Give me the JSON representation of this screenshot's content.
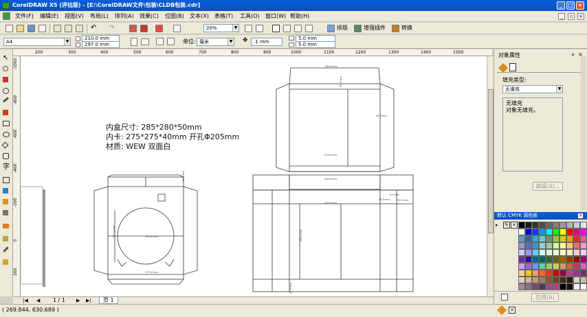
{
  "window": {
    "title": "CorelDRAW X5 (评估版) - [E:\\CorelDRAW文件\\包装\\CLDB包装.cdr]"
  },
  "menu": [
    "文件(F)",
    "编辑(E)",
    "视图(V)",
    "布局(L)",
    "排列(A)",
    "效果(C)",
    "位图(B)",
    "文本(X)",
    "表格(T)",
    "工具(O)",
    "窗口(W)",
    "帮助(H)"
  ],
  "toolbar": {
    "zoom": "20%",
    "layout_label": "排版",
    "plugin_label": "增强插件",
    "convert_label": "转换"
  },
  "property_bar": {
    "paper": "A4",
    "width": "210.0 mm",
    "height": "297.0 mm",
    "unit_label": "单位:",
    "unit": "毫米",
    "nudge": ".1 mm",
    "dup_x": "5.0 mm",
    "dup_y": "5.0 mm"
  },
  "rulers": {
    "h_labels": [
      "200",
      "300",
      "400",
      "500",
      "600",
      "700",
      "800",
      "900",
      "1000",
      "1100",
      "1200",
      "1300",
      "1400",
      "1500"
    ],
    "v_labels": [
      "-1000",
      "-800",
      "-600",
      "-400",
      "-200",
      "0",
      "200"
    ]
  },
  "canvas": {
    "spec_lines": [
      "内盒尺寸: 285*280*50mm",
      "内卡: 275*275*40mm  开孔Φ205mm",
      "材质: WEW  双面白"
    ],
    "dims": {
      "left_top": "40.0 mm",
      "left_side": "275.0 mm",
      "left_center": "205.0 mm",
      "left_bottom": "275.0 mm",
      "right_top": "280.0 mm",
      "right_flap": "45.0 mm",
      "right_mid": "45.0 mm",
      "right_width": "270.0 mm",
      "right_band": "280.0 mm",
      "right_box": "285.0 mm",
      "right_side": "50.0 mm",
      "right_side2": "5.0 mm",
      "right_side3": "50.0 mm",
      "right_vert": "280.0 mm",
      "right_low": "50.0 mm"
    }
  },
  "pages": {
    "nav": "1 / 1",
    "tab": "页 1"
  },
  "status": {
    "coords": "( 269.844, 630.689 )"
  },
  "docker": {
    "title": "对象属性",
    "fill_type_label": "填充类型:",
    "fill_type": "无填充",
    "info_line1": "无填充",
    "info_line2": "对象无填充。",
    "advanced": "高级(A)...",
    "apply": "应用(A)"
  },
  "palette": {
    "title": "默认 CMYK 调色板",
    "colors": [
      "#000000",
      "#1a1a1a",
      "#333333",
      "#4d4d4d",
      "#666666",
      "#808080",
      "#999999",
      "#b3b3b3",
      "#cccccc",
      "#e6e6e6",
      "#ffffff",
      "#0000ff",
      "#003cff",
      "#00a0e9",
      "#00ffff",
      "#00ff00",
      "#ffff00",
      "#ff0000",
      "#e4007f",
      "#ff00ff",
      "#6699cc",
      "#336699",
      "#33aacc",
      "#66cccc",
      "#669966",
      "#99cc33",
      "#cccc33",
      "#ff9900",
      "#cc3333",
      "#cc6699",
      "#9999cc",
      "#6666cc",
      "#3399cc",
      "#99cccc",
      "#99cc99",
      "#ccff99",
      "#ffff99",
      "#ffcc66",
      "#ff6666",
      "#ff99cc",
      "#ccccff",
      "#9999ff",
      "#66ccff",
      "#ccffff",
      "#ccffcc",
      "#e6ffcc",
      "#ffffcc",
      "#ffe6cc",
      "#ffcccc",
      "#ffccff",
      "#663399",
      "#330099",
      "#006699",
      "#006666",
      "#336633",
      "#666600",
      "#996600",
      "#993300",
      "#990000",
      "#990066",
      "#cc99ff",
      "#9966cc",
      "#6699ff",
      "#66cc99",
      "#99cc66",
      "#cccc66",
      "#cc9966",
      "#cc6633",
      "#cc3366",
      "#cc66cc",
      "#ffcc99",
      "#ffcc00",
      "#ff9966",
      "#ff6633",
      "#ff3300",
      "#cc0000",
      "#990033",
      "#cc3399",
      "#993399",
      "#663366",
      "#e8d4b8",
      "#d4b896",
      "#c49a6c",
      "#a67c52",
      "#8b5a2b",
      "#6b4226",
      "#4a2c17",
      "#2b1a0e",
      "#ddd0c0",
      "#c8b8a8",
      "#a08ca0",
      "#8c6e8c",
      "#704a70",
      "#553355",
      "#9a4d8a",
      "#b3408a",
      "#000000",
      "#101010",
      "#f0f0f0",
      "#fafafa"
    ]
  }
}
